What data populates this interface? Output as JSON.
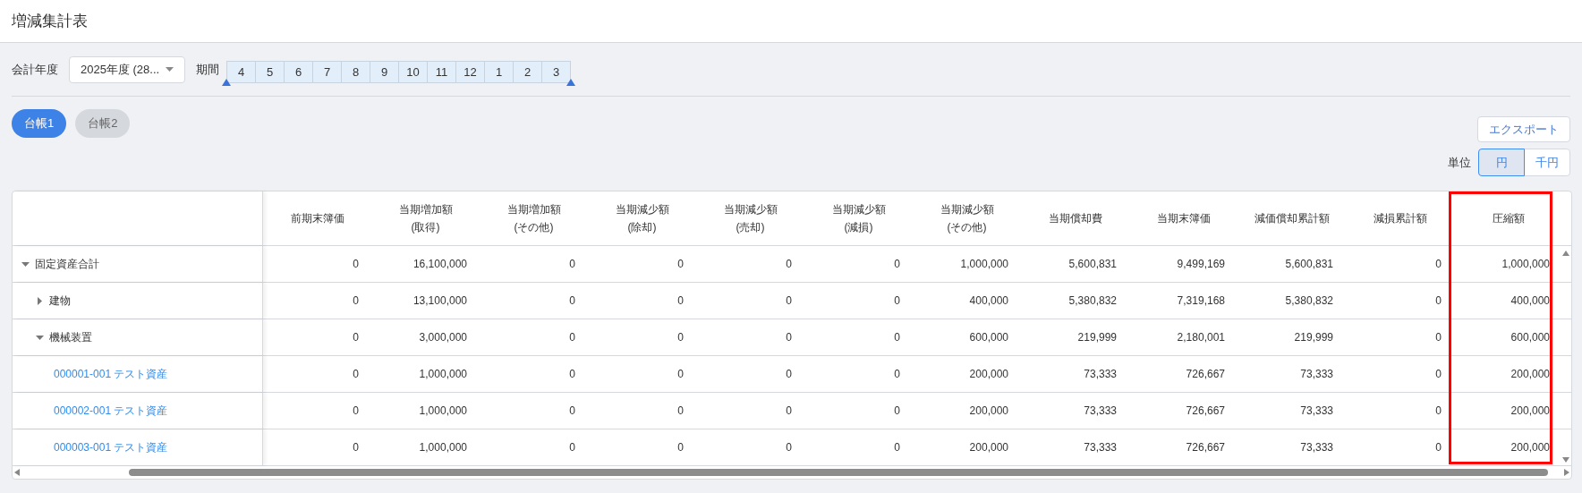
{
  "page_title": "増減集計表",
  "filters": {
    "fiscal_year_label": "会計年度",
    "fiscal_year_value": "2025年度 (28...",
    "period_label": "期間",
    "months": [
      {
        "label": "4",
        "selected": true
      },
      {
        "label": "5",
        "selected": true
      },
      {
        "label": "6",
        "selected": true
      },
      {
        "label": "7",
        "selected": true
      },
      {
        "label": "8",
        "selected": true
      },
      {
        "label": "9",
        "selected": true
      },
      {
        "label": "10",
        "selected": true
      },
      {
        "label": "11",
        "selected": true
      },
      {
        "label": "12",
        "selected": true
      },
      {
        "label": "1",
        "selected": true
      },
      {
        "label": "2",
        "selected": true
      },
      {
        "label": "3",
        "selected": true
      }
    ]
  },
  "ledger_tabs": [
    {
      "label": "台帳1",
      "selected": true
    },
    {
      "label": "台帳2",
      "selected": false
    }
  ],
  "export_button": "エクスポート",
  "unit": {
    "label": "単位",
    "options": [
      {
        "label": "円",
        "selected": true
      },
      {
        "label": "千円",
        "selected": false
      }
    ]
  },
  "table": {
    "columns": [
      {
        "label": "前期末簿価",
        "highlighted": false
      },
      {
        "label": "当期増加額\n(取得)",
        "highlighted": false
      },
      {
        "label": "当期増加額\n(その他)",
        "highlighted": false
      },
      {
        "label": "当期減少額\n(除却)",
        "highlighted": false
      },
      {
        "label": "当期減少額\n(売却)",
        "highlighted": false
      },
      {
        "label": "当期減少額\n(減損)",
        "highlighted": false
      },
      {
        "label": "当期減少額\n(その他)",
        "highlighted": false
      },
      {
        "label": "当期償却費",
        "highlighted": false
      },
      {
        "label": "当期末簿価",
        "highlighted": false
      },
      {
        "label": "減価償却累計額",
        "highlighted": false
      },
      {
        "label": "減損累計額",
        "highlighted": false
      },
      {
        "label": "圧縮額",
        "highlighted": true
      }
    ],
    "rows": [
      {
        "kind": "group",
        "name": "固定資産合計",
        "expanded": true,
        "values": [
          "0",
          "16,100,000",
          "0",
          "0",
          "0",
          "0",
          "1,000,000",
          "5,600,831",
          "9,499,169",
          "5,600,831",
          "0",
          "1,000,000"
        ],
        "children": [
          {
            "kind": "group",
            "name": "建物",
            "expanded": false,
            "values": [
              "0",
              "13,100,000",
              "0",
              "0",
              "0",
              "0",
              "400,000",
              "5,380,832",
              "7,319,168",
              "5,380,832",
              "0",
              "400,000"
            ]
          },
          {
            "kind": "group",
            "name": "機械装置",
            "expanded": true,
            "values": [
              "0",
              "3,000,000",
              "0",
              "0",
              "0",
              "0",
              "600,000",
              "219,999",
              "2,180,001",
              "219,999",
              "0",
              "600,000"
            ],
            "children": [
              {
                "kind": "asset",
                "name": "000001-001 テスト資産",
                "values": [
                  "0",
                  "1,000,000",
                  "0",
                  "0",
                  "0",
                  "0",
                  "200,000",
                  "73,333",
                  "726,667",
                  "73,333",
                  "0",
                  "200,000"
                ]
              },
              {
                "kind": "asset",
                "name": "000002-001 テスト資産",
                "values": [
                  "0",
                  "1,000,000",
                  "0",
                  "0",
                  "0",
                  "0",
                  "200,000",
                  "73,333",
                  "726,667",
                  "73,333",
                  "0",
                  "200,000"
                ]
              },
              {
                "kind": "asset",
                "name": "000003-001 テスト資産",
                "values": [
                  "0",
                  "1,000,000",
                  "0",
                  "0",
                  "0",
                  "0",
                  "200,000",
                  "73,333",
                  "726,667",
                  "73,333",
                  "0",
                  "200,000"
                ]
              }
            ]
          }
        ]
      }
    ]
  }
}
